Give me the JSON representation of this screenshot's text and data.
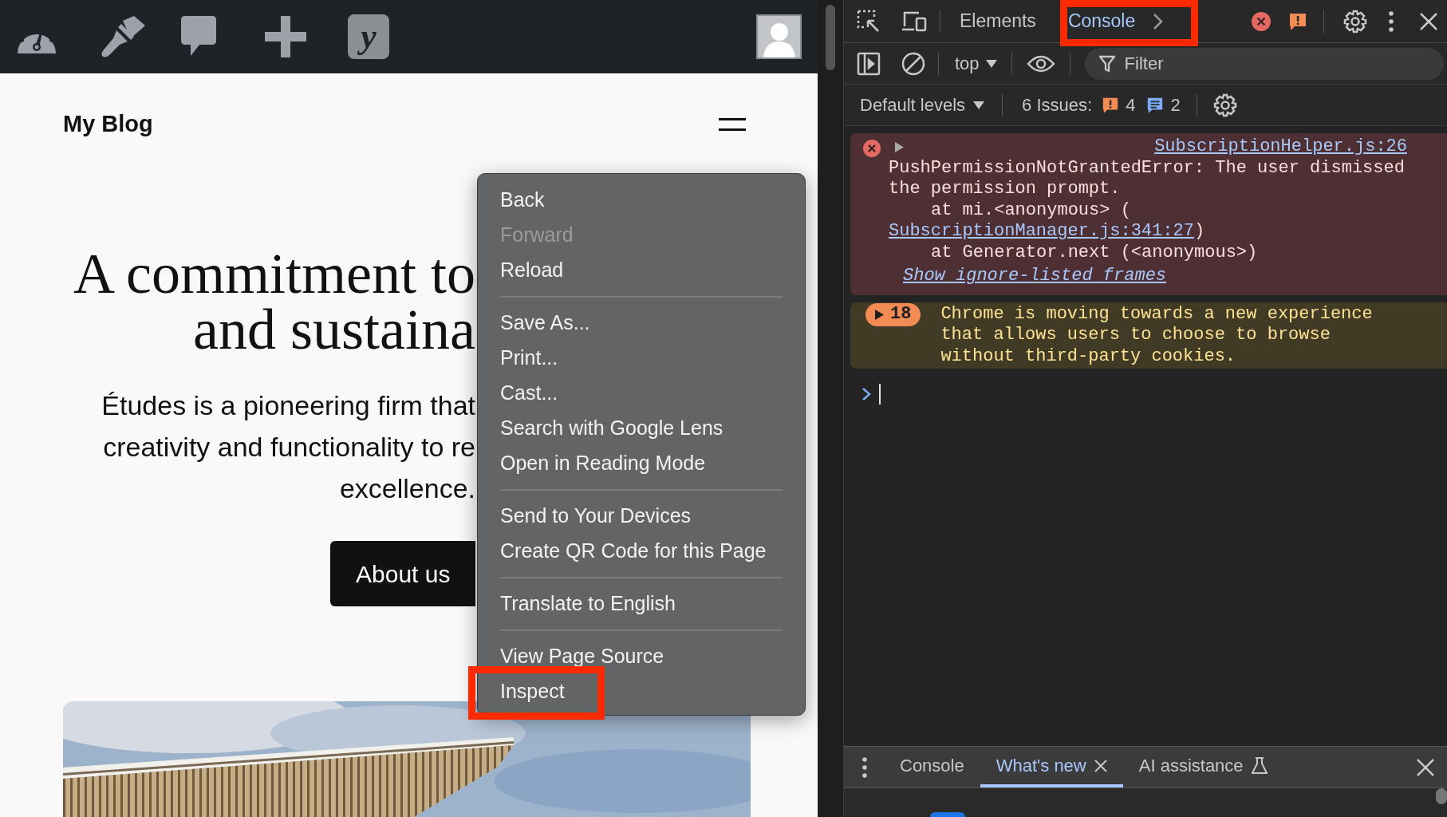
{
  "admin_bar": {
    "logo_letter": "y"
  },
  "site": {
    "title": "My Blog",
    "heading_lines": [
      "A commitment to",
      "and sustaina"
    ],
    "paragraph_lines": [
      "Études is a pioneering firm that",
      "creativity and functionality to re",
      "excellence."
    ],
    "button": "About us",
    "image": {
      "kind": "picture"
    }
  },
  "context_menu": {
    "items": [
      {
        "kind": "item",
        "label": "Back",
        "disabled": false
      },
      {
        "kind": "item",
        "label": "Forward",
        "disabled": true
      },
      {
        "kind": "item",
        "label": "Reload",
        "disabled": false
      },
      {
        "kind": "separator"
      },
      {
        "kind": "item",
        "label": "Save As...",
        "disabled": false
      },
      {
        "kind": "item",
        "label": "Print...",
        "disabled": false
      },
      {
        "kind": "item",
        "label": "Cast...",
        "disabled": false
      },
      {
        "kind": "item",
        "label": "Search with Google Lens",
        "disabled": false
      },
      {
        "kind": "item",
        "label": "Open in Reading Mode",
        "disabled": false
      },
      {
        "kind": "separator"
      },
      {
        "kind": "item",
        "label": "Send to Your Devices",
        "disabled": false
      },
      {
        "kind": "item",
        "label": "Create QR Code for this Page",
        "disabled": false
      },
      {
        "kind": "separator"
      },
      {
        "kind": "item",
        "label": "Translate to English",
        "disabled": false
      },
      {
        "kind": "separator"
      },
      {
        "kind": "item",
        "label": "View Page Source",
        "disabled": false
      },
      {
        "kind": "item",
        "label": "Inspect",
        "disabled": false
      }
    ]
  },
  "devtools": {
    "tabs": [
      {
        "label": "Elements",
        "selected": false
      },
      {
        "label": "Console",
        "selected": true
      }
    ],
    "context": "top",
    "filter_placeholder": "Filter",
    "levels": "Default levels",
    "issues": {
      "label": "6 Issues:",
      "warnings": "4",
      "info": "2"
    },
    "messages": [
      {
        "kind": "error",
        "source": "SubscriptionHelper.js:26",
        "lines": [
          {
            "kind": "message",
            "text": "PushPermissionNotGrantedError: The user dismissed the permission prompt."
          },
          {
            "kind": "frame",
            "text": "at mi.<anonymous> ("
          },
          {
            "kind": "link",
            "link": "SubscriptionManager.js:341:27",
            "text": ")"
          },
          {
            "kind": "frame",
            "text": "at Generator.next (<anonymous>)"
          }
        ],
        "footer_link": "Show ignore-listed frames"
      },
      {
        "kind": "warning",
        "count": "18",
        "text": "Chrome is moving towards a new experience that allows users to choose to browse without third-party cookies."
      }
    ],
    "drawer_tabs": [
      {
        "label": "Console",
        "selected": false,
        "closable": false,
        "experimental": false
      },
      {
        "label": "What's new",
        "selected": true,
        "closable": true,
        "experimental": false
      },
      {
        "label": "AI assistance",
        "selected": false,
        "closable": false,
        "experimental": true
      }
    ]
  }
}
